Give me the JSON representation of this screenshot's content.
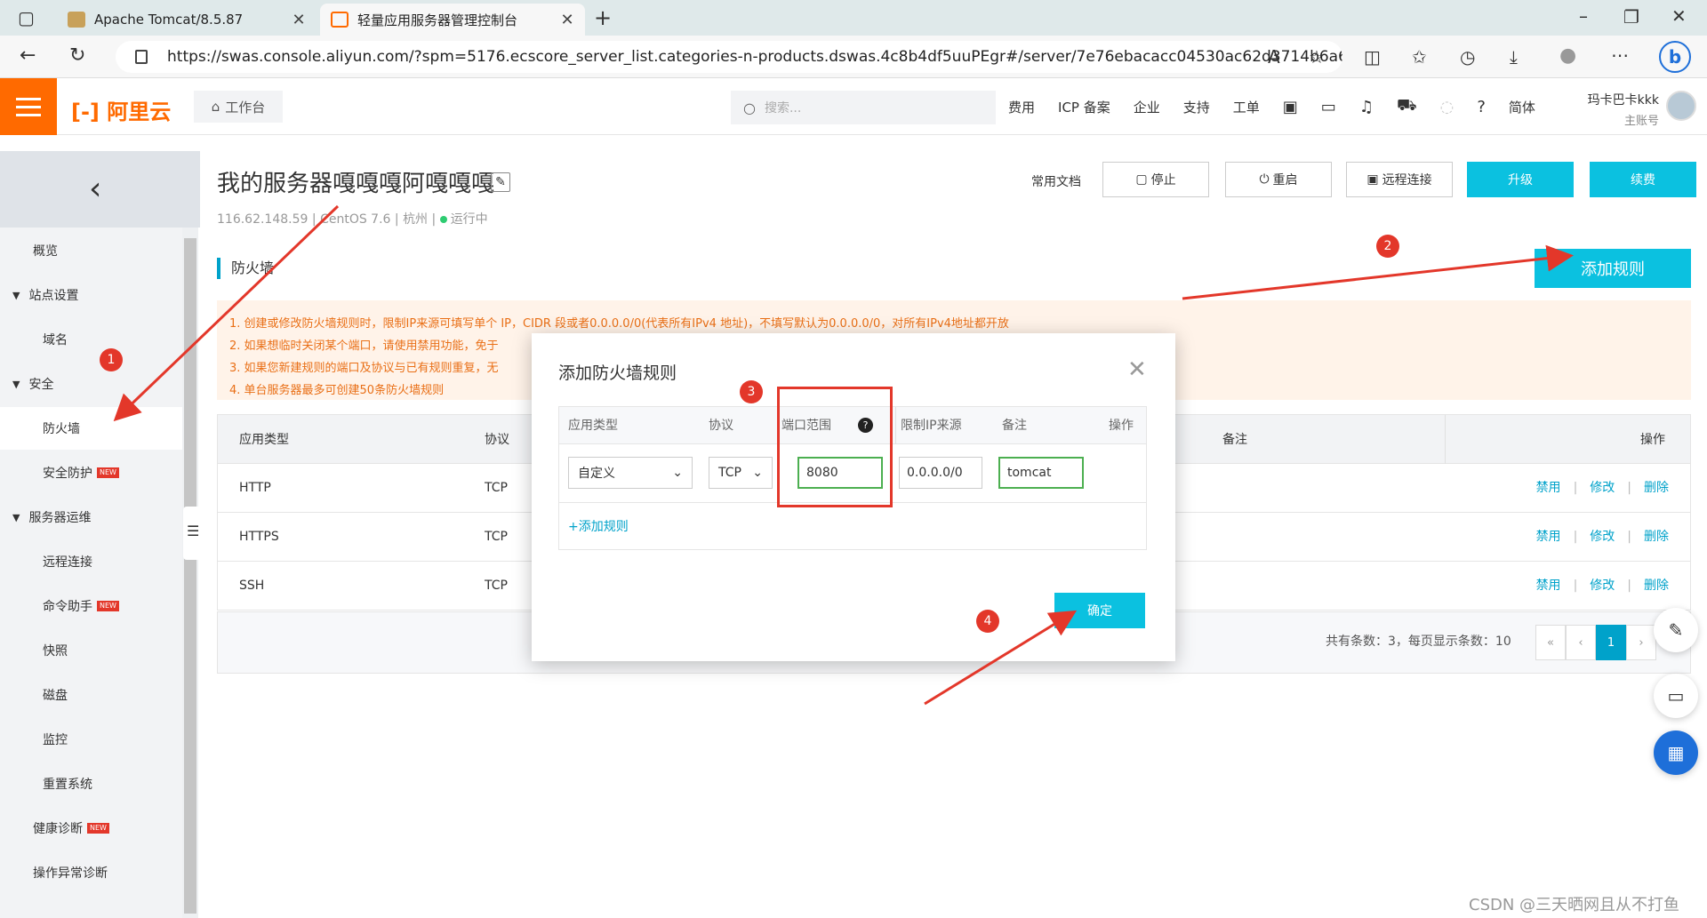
{
  "browser": {
    "tabs": [
      {
        "title": "Apache Tomcat/8.5.87",
        "active": false
      },
      {
        "title": "轻量应用服务器管理控制台",
        "active": true
      }
    ],
    "url": "https://swas.console.aliyun.com/?spm=5176.ecscore_server_list.categories-n-products.dswas.4c8b4df5uuPEgr#/server/7e76ebacacc04530ac62d3714b6a6830..."
  },
  "header": {
    "logo": "阿里云",
    "workbench": "工作台",
    "search_placeholder": "搜索...",
    "nav": [
      "费用",
      "ICP 备案",
      "企业",
      "支持",
      "工单"
    ],
    "lang": "简体",
    "user_name": "玛卡巴卡kkk",
    "user_role": "主账号"
  },
  "sidebar": {
    "items": [
      {
        "label": "概览",
        "kind": "top"
      },
      {
        "label": "站点设置",
        "kind": "group"
      },
      {
        "label": "域名",
        "kind": "sub"
      },
      {
        "label": "安全",
        "kind": "group"
      },
      {
        "label": "防火墙",
        "kind": "sub",
        "active": true
      },
      {
        "label": "安全防护",
        "kind": "sub",
        "new": true
      },
      {
        "label": "服务器运维",
        "kind": "group"
      },
      {
        "label": "远程连接",
        "kind": "sub"
      },
      {
        "label": "命令助手",
        "kind": "sub",
        "new": true
      },
      {
        "label": "快照",
        "kind": "sub"
      },
      {
        "label": "磁盘",
        "kind": "sub"
      },
      {
        "label": "监控",
        "kind": "sub"
      },
      {
        "label": "重置系统",
        "kind": "sub"
      },
      {
        "label": "健康诊断",
        "kind": "top",
        "new": true
      },
      {
        "label": "操作异常诊断",
        "kind": "top"
      }
    ],
    "new_badge": "NEW"
  },
  "server": {
    "title": "我的服务器嘎嘎嘎阿嘎嘎嘎",
    "ip": "116.62.148.59",
    "os": "CentOS 7.6",
    "region": "杭州",
    "status": "运行中"
  },
  "toolbar": {
    "docs": "常用文档",
    "stop": "停止",
    "restart": "重启",
    "remote": "远程连接",
    "upgrade": "升级",
    "renew": "续费"
  },
  "firewall": {
    "section_title": "防火墙",
    "add_rule": "添加规则",
    "notices": [
      "1. 创建或修改防火墙规则时，限制IP来源可填写单个 IP，CIDR 段或者0.0.0.0/0(代表所有IPv4 地址)，不填写默认为0.0.0.0/0，对所有IPv4地址都开放",
      "2. 如果想临时关闭某个端口，请使用禁用功能，免于",
      "3. 如果您新建规则的端口及协议与已有规则重复，无",
      "4. 单台服务器最多可创建50条防火墙规则"
    ],
    "columns": {
      "app_type": "应用类型",
      "protocol": "协议",
      "remark": "备注",
      "ops": "操作"
    },
    "rows": [
      {
        "app": "HTTP",
        "protocol": "TCP"
      },
      {
        "app": "HTTPS",
        "protocol": "TCP"
      },
      {
        "app": "SSH",
        "protocol": "TCP"
      }
    ],
    "ops": {
      "disable": "禁用",
      "edit": "修改",
      "delete": "删除"
    },
    "pagination": {
      "total_text": "共有条数：3，每页显示条数：10",
      "current": "1"
    }
  },
  "modal": {
    "title": "添加防火墙规则",
    "columns": [
      "应用类型",
      "协议",
      "端口范围",
      "限制IP来源",
      "备注",
      "操作"
    ],
    "app_type": "自定义",
    "protocol": "TCP",
    "port": "8080",
    "ip_source": "0.0.0.0/0",
    "remark": "tomcat",
    "add_rule": "+添加规则",
    "confirm": "确定"
  },
  "annotations": [
    "1",
    "2",
    "3",
    "4"
  ],
  "watermark": "CSDN @三天晒网且从不打鱼",
  "colors": {
    "brand": "#ff6a00",
    "primary": "#00a2ca",
    "accent": "#0bc1e0",
    "annotation": "#e3372a"
  }
}
